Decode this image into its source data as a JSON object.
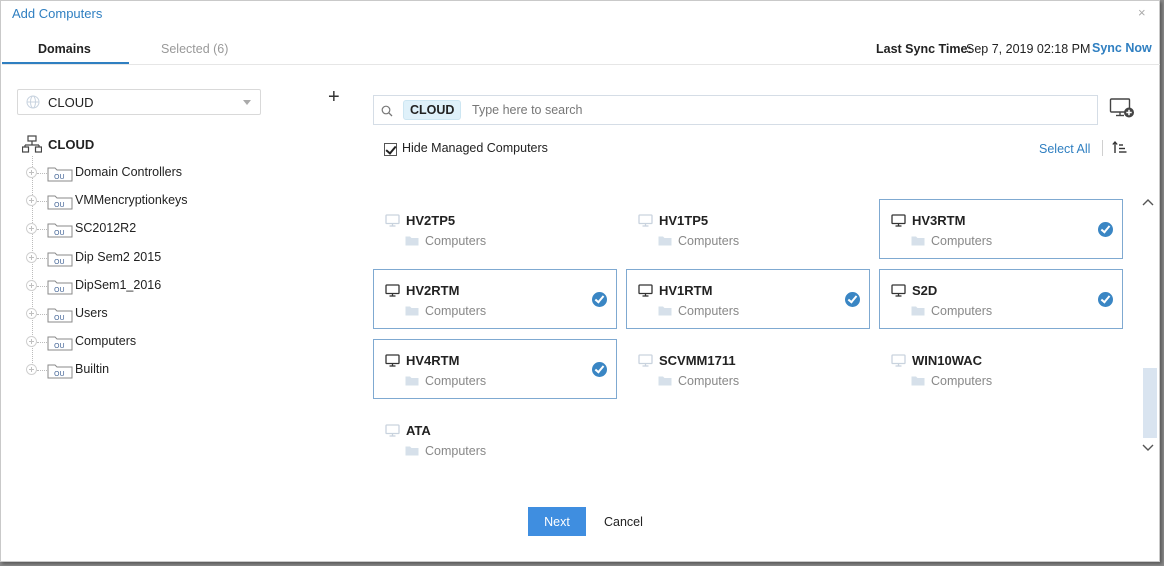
{
  "dialog": {
    "title": "Add Computers",
    "close": "×"
  },
  "tabs": [
    {
      "label": "Domains",
      "active": true
    },
    {
      "label": "Selected (6)",
      "active": false
    }
  ],
  "sync": {
    "label": "Last Sync Time:",
    "time": "Sep 7, 2019 02:18 PM",
    "action": "Sync Now"
  },
  "domain_select": {
    "value": "CLOUD"
  },
  "tree": {
    "root": "CLOUD",
    "items": [
      {
        "label": "Domain Controllers",
        "icon": "ou-folder-icon"
      },
      {
        "label": "VMMencryptionkeys",
        "icon": "ou-folder-icon"
      },
      {
        "label": "SC2012R2",
        "icon": "ou-folder-icon"
      },
      {
        "label": "Dip Sem2 2015",
        "icon": "ou-folder-icon"
      },
      {
        "label": "DipSem1_2016",
        "icon": "ou-folder-icon"
      },
      {
        "label": "Users",
        "icon": "ou-folder-icon"
      },
      {
        "label": "Computers",
        "icon": "ou-folder-icon"
      },
      {
        "label": "Builtin",
        "icon": "ou-folder-icon"
      }
    ]
  },
  "search": {
    "tag": "CLOUD",
    "placeholder": "Type here to search",
    "value": ""
  },
  "filters": {
    "hide_managed_label": "Hide Managed Computers",
    "hide_managed_checked": true,
    "select_all": "Select All"
  },
  "computers": [
    {
      "name": "HV2TP5",
      "container": "Computers",
      "selected": false
    },
    {
      "name": "HV1TP5",
      "container": "Computers",
      "selected": false
    },
    {
      "name": "HV3RTM",
      "container": "Computers",
      "selected": true
    },
    {
      "name": "HV2RTM",
      "container": "Computers",
      "selected": true
    },
    {
      "name": "HV1RTM",
      "container": "Computers",
      "selected": true
    },
    {
      "name": "S2D",
      "container": "Computers",
      "selected": true
    },
    {
      "name": "HV4RTM",
      "container": "Computers",
      "selected": true
    },
    {
      "name": "SCVMM1711",
      "container": "Computers",
      "selected": false
    },
    {
      "name": "WIN10WAC",
      "container": "Computers",
      "selected": false
    },
    {
      "name": "ATA",
      "container": "Computers",
      "selected": false
    }
  ],
  "buttons": {
    "next": "Next",
    "cancel": "Cancel"
  },
  "colors": {
    "accent": "#2f7fc1",
    "primary_button": "#3f8ee0",
    "selected_border": "#7fa9d1",
    "check": "#3a86c4"
  }
}
